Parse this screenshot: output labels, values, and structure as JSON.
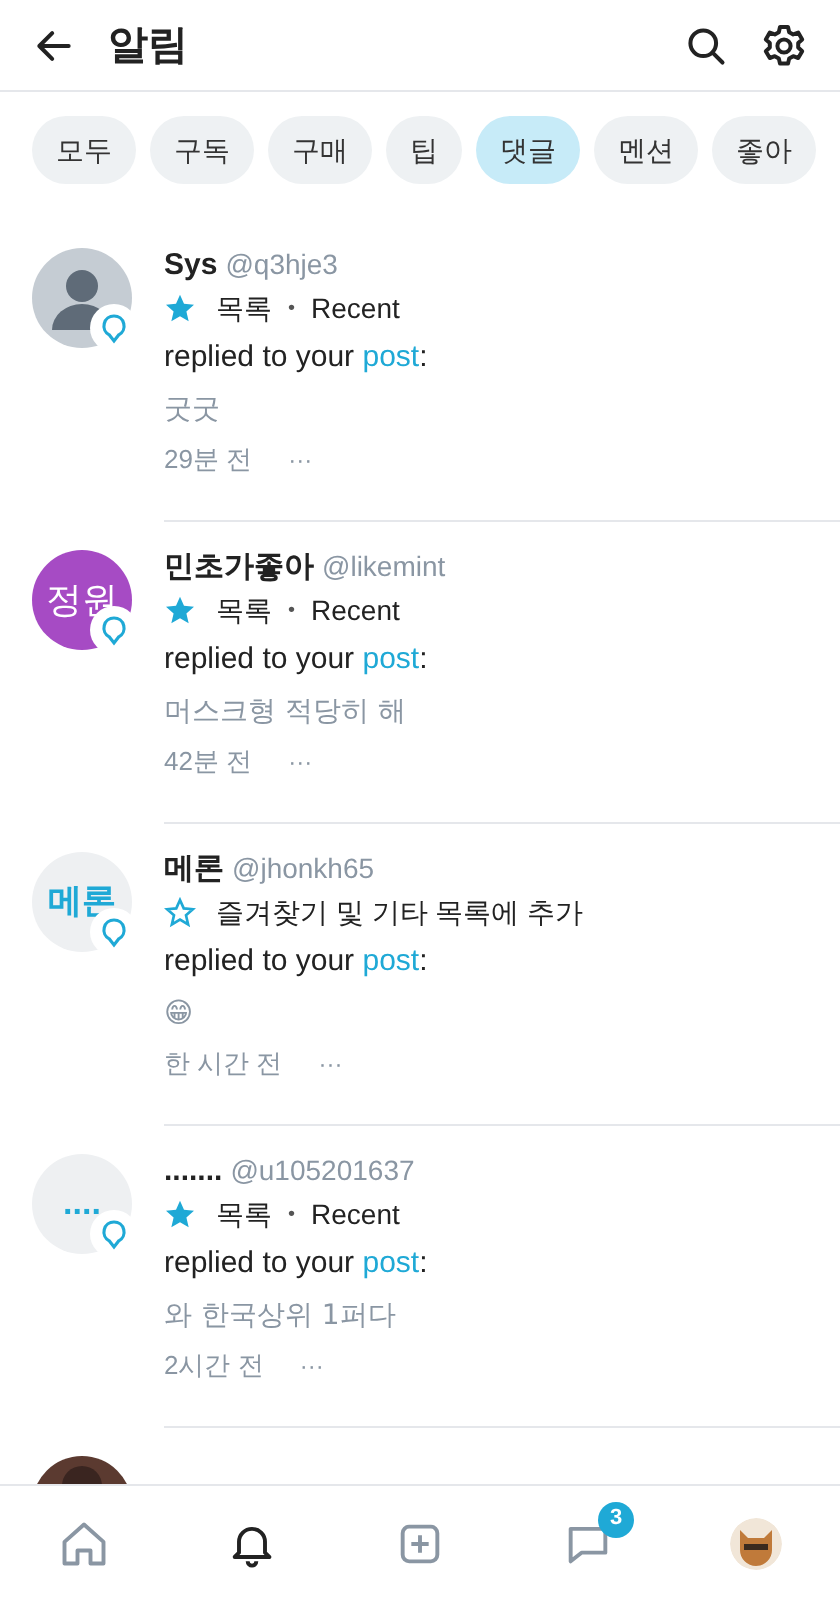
{
  "header": {
    "title": "알림"
  },
  "filters": [
    {
      "label": "모두",
      "selected": false
    },
    {
      "label": "구독",
      "selected": false
    },
    {
      "label": "구매",
      "selected": false
    },
    {
      "label": "팁",
      "selected": false
    },
    {
      "label": "댓글",
      "selected": true
    },
    {
      "label": "멘션",
      "selected": false
    },
    {
      "label": "좋아",
      "selected": false
    }
  ],
  "notifications": [
    {
      "avatar": {
        "kind": "silhouette"
      },
      "name": "Sys",
      "handle": "@q3hje3",
      "favorite": true,
      "list": "목록",
      "separator": "•",
      "list_tag": "Recent",
      "action": "replied to your ",
      "link": "post",
      "colon": ":",
      "comment": "굿굿",
      "time": "29분 전",
      "more": "···"
    },
    {
      "avatar": {
        "kind": "initials",
        "text": "정원",
        "color": "#a64bc4"
      },
      "name": "민초가좋아",
      "handle": "@likemint",
      "favorite": true,
      "list": "목록",
      "separator": "•",
      "list_tag": "Recent",
      "action": "replied to your ",
      "link": "post",
      "colon": ":",
      "comment": "머스크형 적당히 해",
      "time": "42분 전",
      "more": "···"
    },
    {
      "avatar": {
        "kind": "initials_light",
        "text": "메론"
      },
      "name": "메론",
      "handle": "@jhonkh65",
      "favorite": false,
      "list": "즐겨찾기 및 기타 목록에 추가",
      "action": "replied to your ",
      "link": "post",
      "colon": ":",
      "comment": "😁",
      "time": "한 시간 전",
      "more": "···"
    },
    {
      "avatar": {
        "kind": "initials_light",
        "text": "...."
      },
      "name": ".......",
      "handle": "@u105201637",
      "favorite": true,
      "list": "목록",
      "separator": "•",
      "list_tag": "Recent",
      "action": "replied to your ",
      "link": "post",
      "colon": ":",
      "comment": "와 한국상위 1퍼다",
      "time": "2시간 전",
      "more": "···"
    },
    {
      "avatar": {
        "kind": "picture"
      }
    }
  ],
  "bottom_nav": [
    {
      "kind": "home",
      "selected": false
    },
    {
      "kind": "bell",
      "selected": true
    },
    {
      "kind": "add",
      "selected": false
    },
    {
      "kind": "messages",
      "selected": false,
      "badge": "3"
    },
    {
      "kind": "profile"
    }
  ]
}
